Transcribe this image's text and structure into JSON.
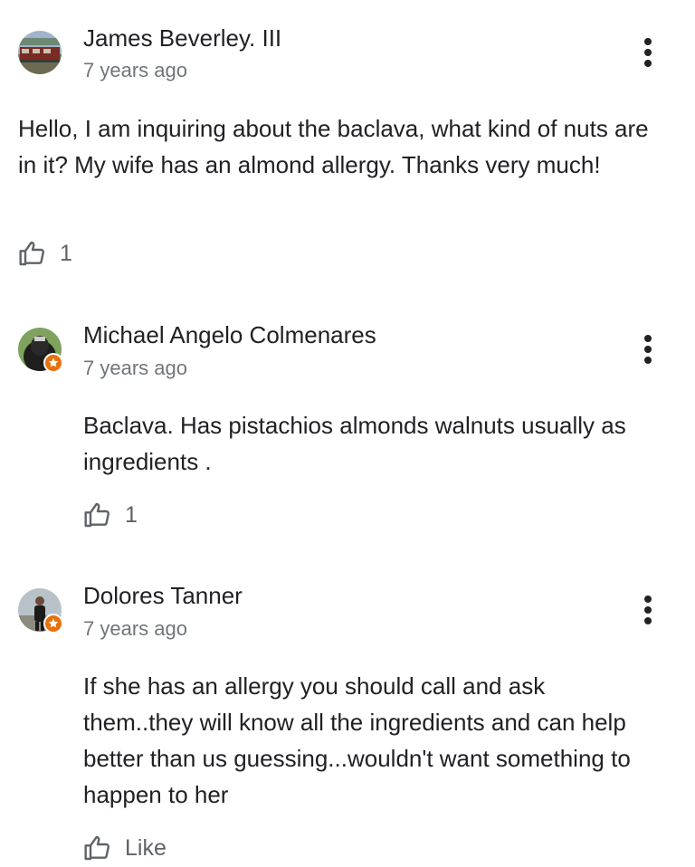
{
  "comments": [
    {
      "author": "James Beverley. III",
      "time": "7 years ago",
      "text": "Hello, I am inquiring about the baclava, what kind of nuts are in it? My wife has an almond allergy. Thanks very much!",
      "likes": "1",
      "is_reply": false,
      "local_guide": false
    },
    {
      "author": "Michael Angelo Colmenares",
      "time": "7 years ago",
      "text": "Baclava. Has pistachios almonds walnuts usually as ingredients .",
      "likes": "1",
      "is_reply": true,
      "local_guide": true
    },
    {
      "author": "Dolores Tanner",
      "time": "7 years ago",
      "text": "If she has an allergy you should call and ask them..they will know all the ingredients and can help better than us guessing...wouldn't want something to happen to her",
      "likes": "Like",
      "is_reply": true,
      "local_guide": true
    }
  ],
  "icons": {
    "more": "more-vert-icon",
    "like": "thumb-up-outline-icon",
    "badge": "local-guide-badge-icon"
  },
  "colors": {
    "text_primary": "#202124",
    "text_secondary": "#70757a",
    "icon_gray": "#5f6368",
    "badge_orange": "#e8710a"
  }
}
